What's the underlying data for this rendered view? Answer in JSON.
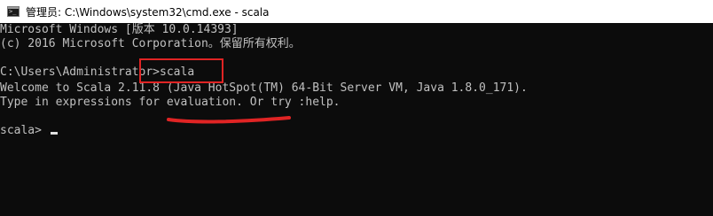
{
  "window": {
    "icon": "cmd-console-icon",
    "title": "管理员: C:\\Windows\\system32\\cmd.exe - scala"
  },
  "console": {
    "lines": [
      "Microsoft Windows [版本 10.0.14393]",
      "(c) 2016 Microsoft Corporation。保留所有权利。",
      "C:\\Users\\Administrator>scala",
      "Welcome to Scala 2.11.8 (Java HotSpot(TM) 64-Bit Server VM, Java 1.8.0_171).",
      "Type in expressions for evaluation. Or try :help.",
      "scala> "
    ]
  },
  "annotations": {
    "color": "#e02424"
  },
  "colors": {
    "console_bg": "#0c0c0c",
    "console_fg": "#c0c0c0",
    "titlebar_bg": "#ffffff"
  }
}
